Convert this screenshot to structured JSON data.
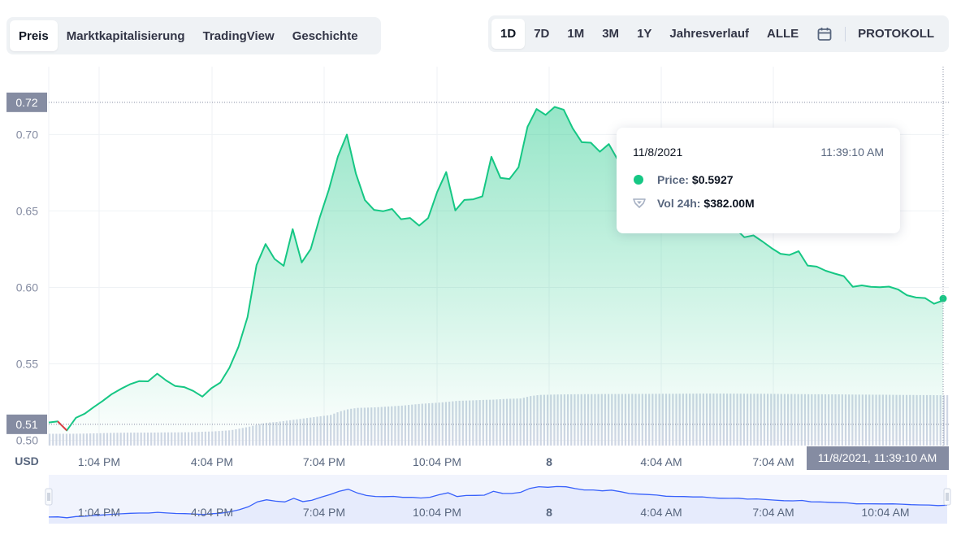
{
  "tabs": [
    {
      "label": "Preis",
      "active": true
    },
    {
      "label": "Marktkapitalisierung",
      "active": false
    },
    {
      "label": "TradingView",
      "active": false
    },
    {
      "label": "Geschichte",
      "active": false
    }
  ],
  "ranges": [
    {
      "label": "1D",
      "active": true
    },
    {
      "label": "7D",
      "active": false
    },
    {
      "label": "1M",
      "active": false
    },
    {
      "label": "3M",
      "active": false
    },
    {
      "label": "1Y",
      "active": false
    },
    {
      "label": "Jahresverlauf",
      "active": false
    },
    {
      "label": "ALLE",
      "active": false
    }
  ],
  "protokoll_label": "PROTOKOLL",
  "calendar_icon": "calendar-icon",
  "tooltip": {
    "date": "11/8/2021",
    "time": "11:39:10 AM",
    "price_label": "Price:",
    "price_value": "$0.5927",
    "vol_label": "Vol 24h:",
    "vol_value": "$382.00M"
  },
  "colors": {
    "line": "#16c784",
    "negative": "#ea3943",
    "volume": "#cfd6e4",
    "navigator_line": "#3861fb",
    "navigator_fill": "#e6ebfc",
    "label_bg": "#858ca2"
  },
  "chart_data": {
    "type": "area",
    "currency_label": "USD",
    "y_ticks": [
      "0.50",
      "0.55",
      "0.60",
      "0.65",
      "0.70"
    ],
    "y_tick_values": [
      0.5,
      0.55,
      0.6,
      0.65,
      0.7
    ],
    "ylim": [
      0.4966,
      0.7443
    ],
    "x_ticks": [
      "1:04 PM",
      "4:04 PM",
      "7:04 PM",
      "10:04 PM",
      "8",
      "4:04 AM",
      "7:04 AM"
    ],
    "navigator_ticks": [
      "1:04 PM",
      "4:04 PM",
      "7:04 PM",
      "10:04 PM",
      "8",
      "4:04 AM",
      "7:04 AM",
      "10:04 AM"
    ],
    "grid": true,
    "high_label": "0.72",
    "high_value": 0.721,
    "low_label": "0.51",
    "low_value": 0.5105,
    "crosshair_label": "11/8/2021, 11:39:10 AM",
    "current_value": 0.5927,
    "price_series": [
      0.5117,
      0.5124,
      0.5065,
      0.5147,
      0.5175,
      0.5218,
      0.5259,
      0.5303,
      0.5337,
      0.5367,
      0.5387,
      0.5386,
      0.5436,
      0.5391,
      0.5355,
      0.5348,
      0.5323,
      0.5286,
      0.5341,
      0.5378,
      0.5474,
      0.5611,
      0.5806,
      0.6146,
      0.6283,
      0.6186,
      0.6141,
      0.6381,
      0.6163,
      0.6251,
      0.6457,
      0.6639,
      0.6855,
      0.6999,
      0.6744,
      0.6571,
      0.6507,
      0.6498,
      0.6513,
      0.6446,
      0.6454,
      0.6404,
      0.6454,
      0.6624,
      0.6754,
      0.6503,
      0.6572,
      0.6576,
      0.6595,
      0.6854,
      0.6716,
      0.6709,
      0.6785,
      0.705,
      0.7166,
      0.7128,
      0.718,
      0.7162,
      0.704,
      0.6949,
      0.6946,
      0.6887,
      0.6937,
      0.6832,
      0.6704,
      0.6665,
      0.6639,
      0.6603,
      0.6522,
      0.6505,
      0.65,
      0.6475,
      0.6478,
      0.6424,
      0.6388,
      0.6379,
      0.6385,
      0.6328,
      0.634,
      0.63,
      0.6257,
      0.622,
      0.6212,
      0.6237,
      0.6143,
      0.6136,
      0.6109,
      0.609,
      0.6074,
      0.6004,
      0.6013,
      0.6004,
      0.6001,
      0.6005,
      0.5987,
      0.5949,
      0.5934,
      0.593,
      0.5893,
      0.5915
    ],
    "volume_series": [
      1.0,
      1.0,
      1.0,
      1.01,
      1.02,
      1.04,
      1.06,
      1.08,
      1.09,
      1.1,
      1.1,
      1.1,
      1.11,
      1.12,
      1.12,
      1.13,
      1.14,
      1.18,
      1.2,
      1.25,
      1.3,
      1.45,
      1.6,
      1.8,
      1.95,
      2.0,
      2.1,
      2.2,
      2.3,
      2.4,
      2.5,
      2.6,
      2.9,
      3.1,
      3.2,
      3.22,
      3.25,
      3.3,
      3.35,
      3.4,
      3.48,
      3.55,
      3.6,
      3.65,
      3.72,
      3.8,
      3.82,
      3.85,
      3.88,
      3.9,
      3.95,
      3.98,
      4.0,
      4.2,
      4.3,
      4.32,
      4.34,
      4.35,
      4.36,
      4.37,
      4.37,
      4.38,
      4.38,
      4.38,
      4.39,
      4.39,
      4.39,
      4.4,
      4.4,
      4.4,
      4.41,
      4.41,
      4.42,
      4.42,
      4.42,
      4.41,
      4.41,
      4.4,
      4.4,
      4.4,
      4.39,
      4.38,
      4.38,
      4.37,
      4.36,
      4.36,
      4.35,
      4.35,
      4.34,
      4.33,
      4.33,
      4.32,
      4.32,
      4.31,
      4.3,
      4.3,
      4.29,
      4.29,
      4.28,
      4.28
    ]
  }
}
